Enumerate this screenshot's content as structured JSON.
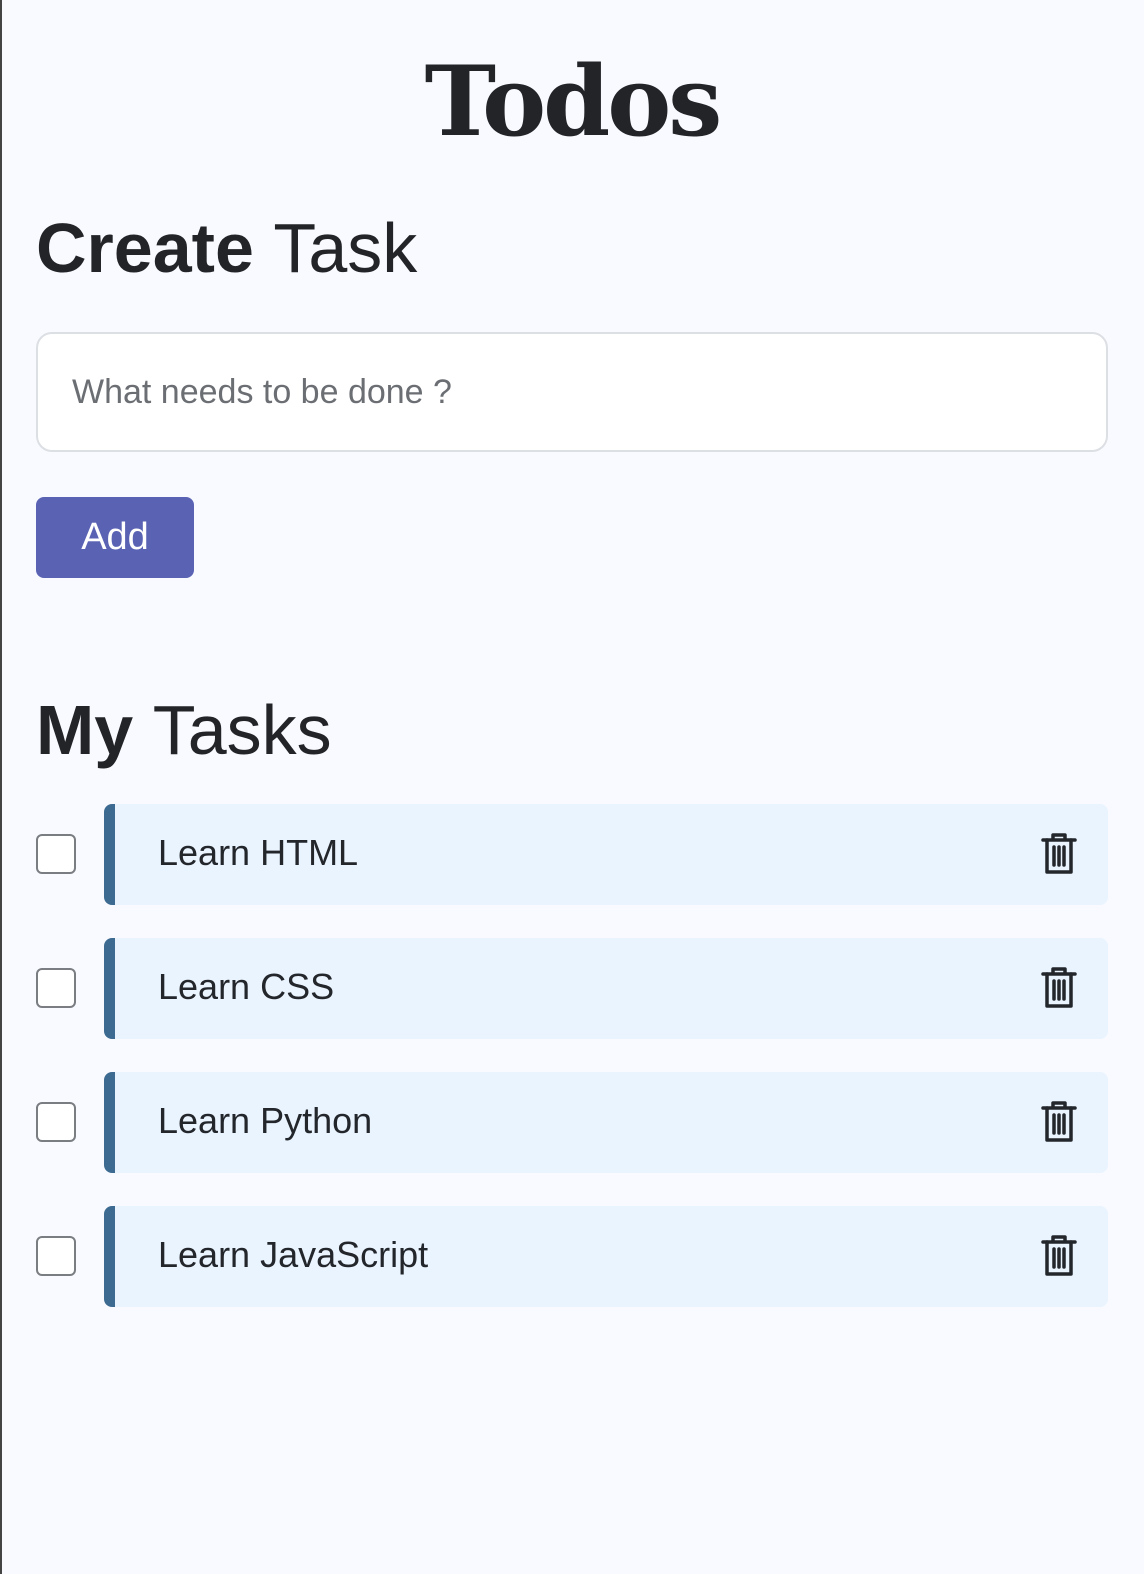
{
  "header": {
    "title": "Todos"
  },
  "create": {
    "heading_bold": "Create",
    "heading_light": "Task",
    "input_placeholder": "What needs to be done ?",
    "input_value": "",
    "add_label": "Add"
  },
  "tasks": {
    "heading_bold": "My",
    "heading_light": "Tasks",
    "items": [
      {
        "label": "Learn HTML",
        "done": false,
        "delete_icon": "trash-icon"
      },
      {
        "label": "Learn CSS",
        "done": false,
        "delete_icon": "trash-icon"
      },
      {
        "label": "Learn Python",
        "done": false,
        "delete_icon": "trash-icon"
      },
      {
        "label": "Learn JavaScript",
        "done": false,
        "delete_icon": "trash-icon"
      }
    ]
  },
  "colors": {
    "background": "#f8faff",
    "accent": "#5a62b4",
    "task_card": "#eaf4ff",
    "task_border": "#3d6a90",
    "text": "#23262b"
  }
}
